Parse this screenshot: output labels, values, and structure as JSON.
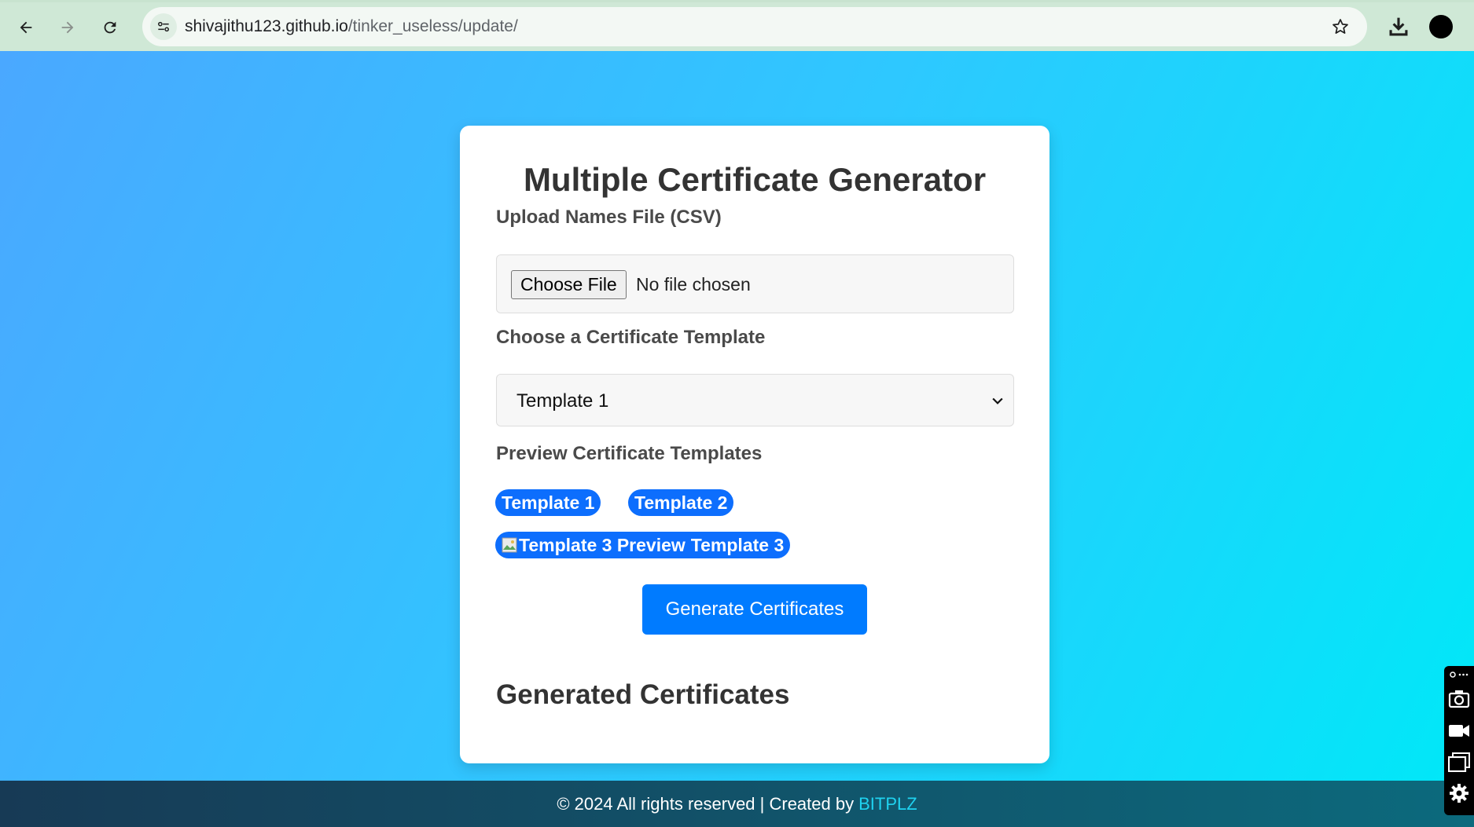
{
  "browser": {
    "url_host": "shivajithu123.github.io",
    "url_path": "/tinker_useless/update/",
    "icons": [
      "back-arrow-icon",
      "forward-arrow-icon",
      "reload-icon",
      "site-info-icon",
      "star-icon",
      "download-icon",
      "profile-icon"
    ]
  },
  "card": {
    "title": "Multiple Certificate Generator",
    "upload_label": "Upload Names File (CSV)",
    "choose_file_label": "Choose File",
    "no_file_text": "No file chosen",
    "template_label": "Choose a Certificate Template",
    "selected_template": "Template 1",
    "preview_label": "Preview Certificate Templates",
    "preview_chips": [
      "Template 1",
      "Template 2"
    ],
    "preview_chip_3_alt": "Template 3 Preview",
    "preview_chip_3_label": "Template 3",
    "generate_button": "Generate Certificates",
    "generated_heading": "Generated Certificates"
  },
  "footer": {
    "text": "© 2024 All rights reserved | Created by",
    "link": "BITPLZ"
  },
  "colors": {
    "accent": "#0d6efd",
    "button": "#007bff",
    "footer_link": "#1fd2f0"
  }
}
